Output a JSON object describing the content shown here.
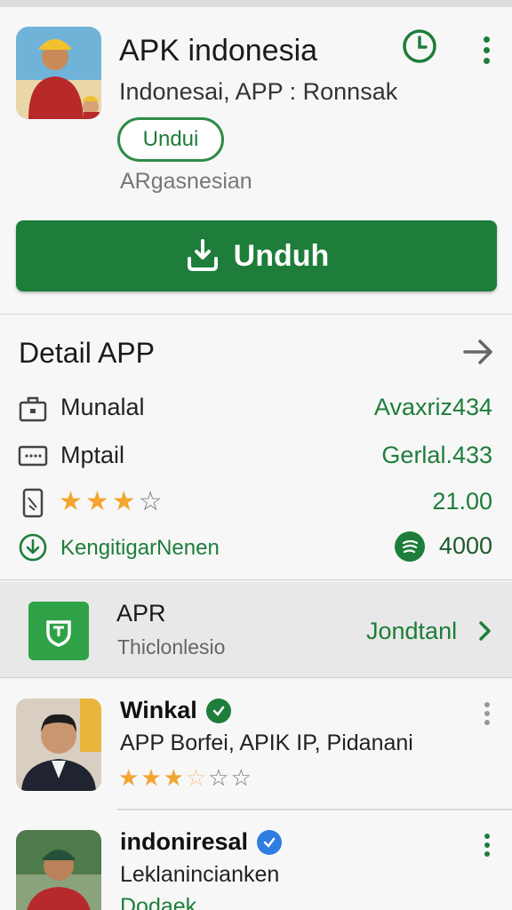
{
  "app": {
    "title": "APK indonesia",
    "subtitle": "Indonesai, APP : Ronnsak",
    "pill_label": "Undui",
    "developer": "ARgasnesian",
    "install_label": "Unduh"
  },
  "detail": {
    "title": "Detail APP",
    "rows": [
      {
        "label": "Munalal",
        "value": "Avaxriz434",
        "icon": "briefcase-icon"
      },
      {
        "label": "Mptail",
        "value": "Gerlal.433",
        "icon": "keyboard-icon"
      },
      {
        "label": "",
        "value": "21.00",
        "icon": "phone-icon",
        "rating": 3,
        "max": 4
      },
      {
        "label": "KengitigarNenen",
        "value": "4000",
        "icon": "download-circle-icon"
      }
    ]
  },
  "featured": {
    "title": "APR",
    "subtitle": "Thiclonlesio",
    "link": "Jondtanl"
  },
  "list": [
    {
      "title": "Winkal",
      "subtitle": "APP Borfei, APIK IP, Pidanani",
      "rating": 3.5,
      "max": 5,
      "badge": "green-check-badge"
    },
    {
      "title": "indoniresal",
      "subtitle": "Leklanincianken",
      "extra": "Dodaek",
      "badge": "blue-check-badge"
    }
  ],
  "colors": {
    "accent": "#1e7d3a",
    "star": "#f2a531",
    "verified_blue": "#2f7de0"
  }
}
